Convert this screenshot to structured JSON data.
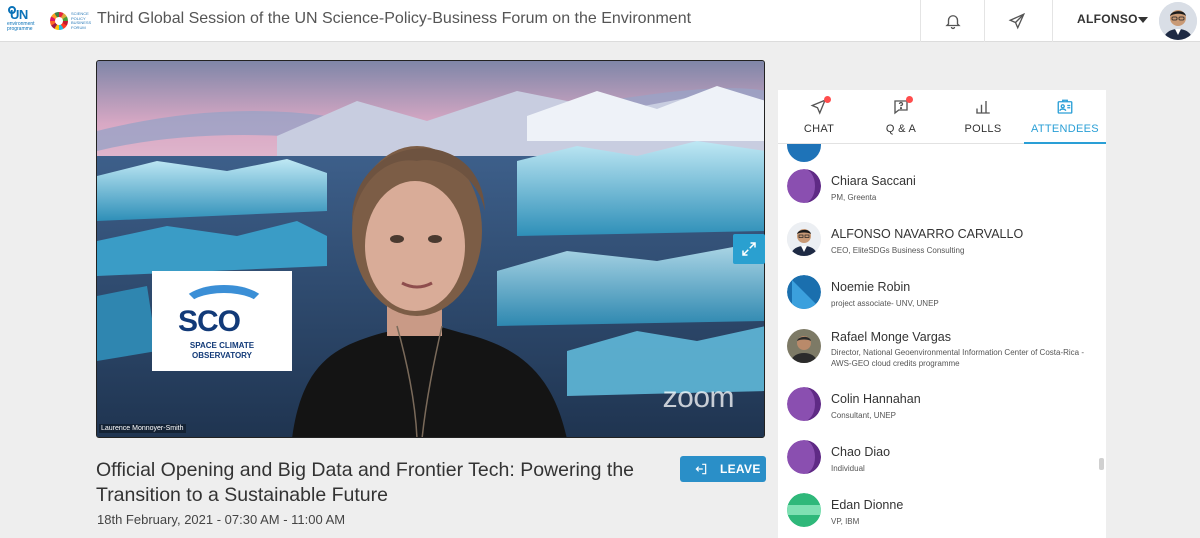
{
  "header": {
    "event_title": "Third Global Session of the UN Science-Policy-Business Forum on the Environment",
    "un_logo": "UN",
    "un_logo_sub": "environment programme",
    "spbf_logo": "SCIENCE POLICY BUSINESS FORUM",
    "user_name": "ALFONSO",
    "notifications_icon": "bell-icon",
    "send_icon": "paper-plane-icon"
  },
  "video": {
    "speaker_name": "Laurence Monnoyer-Smith",
    "watermark": "zoom",
    "sco_logo": "SCO",
    "sco_line1": "SPACE CLIMATE",
    "sco_line2": "OBSERVATORY"
  },
  "session": {
    "title": "Official Opening and Big Data and Frontier Tech: Powering the Transition to a Sustainable Future",
    "date": "18th February, 2021 - 07:30 AM - 11:00 AM",
    "leave_label": "LEAVE"
  },
  "tabs": [
    {
      "label": "CHAT",
      "icon": "chat-icon",
      "badge": true
    },
    {
      "label": "Q & A",
      "icon": "question-icon",
      "badge": true
    },
    {
      "label": "POLLS",
      "icon": "bar-chart-icon",
      "badge": false
    },
    {
      "label": "ATTENDEES",
      "icon": "attendees-icon",
      "badge": false,
      "active": true
    }
  ],
  "attendees": [
    {
      "name": "Chiara Saccani",
      "role": "PM, Greenta",
      "avatar_color": "#7a3fa0"
    },
    {
      "name": "ALFONSO NAVARRO CARVALLO",
      "role": "CEO, EliteSDGs Business Consulting",
      "avatar_color": "photo"
    },
    {
      "name": "Noemie Robin",
      "role": "project associate- UNV, UNEP",
      "avatar_color": "#1e73b8"
    },
    {
      "name": "Rafael Monge Vargas",
      "role": "Director, National Geoenvironmental Information Center of Costa-Rica - AWS-GEO cloud credits programme",
      "avatar_color": "photo"
    },
    {
      "name": "Colin Hannahan",
      "role": "Consultant, UNEP",
      "avatar_color": "#7a3fa0"
    },
    {
      "name": "Chao Diao",
      "role": "Individual",
      "avatar_color": "#7a3fa0"
    },
    {
      "name": "Edan Dionne",
      "role": "VP, IBM",
      "avatar_color": "#2fb87a"
    }
  ],
  "colors": {
    "accent": "#2a9fd6",
    "leave_button": "#2a8fc8"
  }
}
